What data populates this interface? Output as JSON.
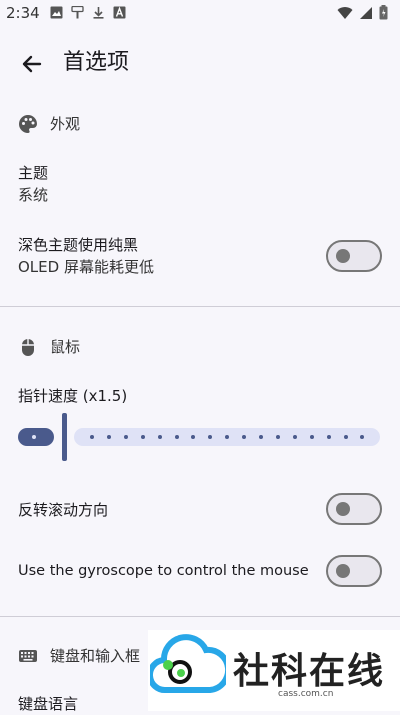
{
  "status_bar": {
    "time": "2:34"
  },
  "header": {
    "title": "首选项"
  },
  "appearance": {
    "header": "外观",
    "theme": {
      "title": "主题",
      "summary": "系统"
    },
    "black_theme": {
      "title": "深色主题使用纯黑",
      "summary": "OLED 屏幕能耗更低",
      "enabled": false
    }
  },
  "mouse": {
    "header": "鼠标",
    "pointer_speed": {
      "label": "指针速度 (x1.5)"
    },
    "reverse_scroll": {
      "title": "反转滚动方向",
      "enabled": false
    },
    "gyroscope": {
      "title": "Use the gyroscope to control the mouse",
      "enabled": false
    }
  },
  "keyboard": {
    "header": "键盘和输入框",
    "language": {
      "title": "键盘语言"
    }
  },
  "watermark": {
    "text": "社科在线",
    "url": "cass.com.cn"
  },
  "colors": {
    "accent": "#4a5a8c",
    "track": "#dfe2f6",
    "background": "#f7f6fb"
  }
}
